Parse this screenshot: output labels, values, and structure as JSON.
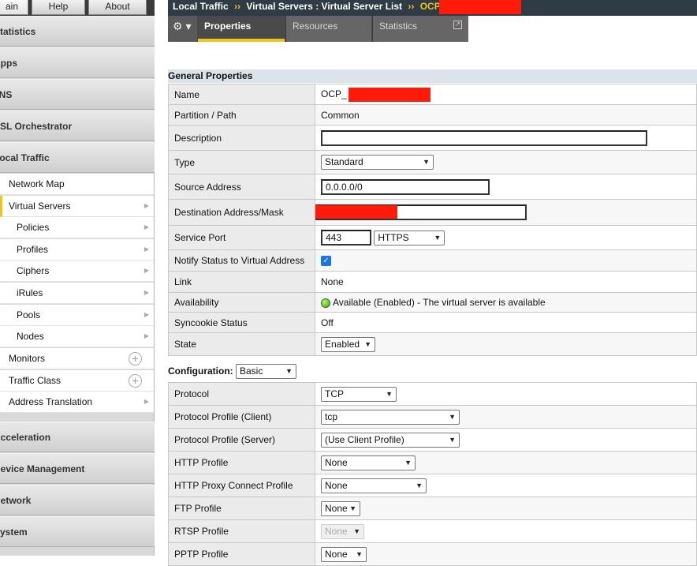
{
  "topnav": {
    "tabs": [
      "ain",
      "Help",
      "About"
    ]
  },
  "sidebar": {
    "sections_top": [
      "Statistics",
      "Apps",
      "DNS",
      "SSL Orchestrator",
      "Local Traffic"
    ],
    "local_traffic_items": [
      {
        "label": "Network Map",
        "level": 1,
        "marker": "none"
      },
      {
        "label": "Virtual Servers",
        "level": 1,
        "marker": "arrow"
      },
      {
        "label": "Policies",
        "level": 2,
        "marker": "arrow"
      },
      {
        "label": "Profiles",
        "level": 2,
        "marker": "arrow"
      },
      {
        "label": "Ciphers",
        "level": 2,
        "marker": "arrow"
      },
      {
        "label": "iRules",
        "level": 2,
        "marker": "arrow"
      },
      {
        "label": "Pools",
        "level": 2,
        "marker": "arrow"
      },
      {
        "label": "Nodes",
        "level": 2,
        "marker": "arrow"
      },
      {
        "label": "Monitors",
        "level": 1,
        "marker": "plus"
      },
      {
        "label": "Traffic Class",
        "level": 1,
        "marker": "plus"
      },
      {
        "label": "Address Translation",
        "level": 1,
        "marker": "arrow"
      }
    ],
    "sections_bottom": [
      "Acceleration",
      "Device Management",
      "Network",
      "System"
    ]
  },
  "header": {
    "crumb1": "Local Traffic",
    "crumb2": "Virtual Servers : Virtual Server List",
    "current": "OCP_",
    "sep": "››"
  },
  "tabs": {
    "gear": "⚙ ▾",
    "properties": "Properties",
    "resources": "Resources",
    "statistics": "Statistics"
  },
  "general": {
    "title": "General Properties",
    "name_label": "Name",
    "name_value": "OCP_",
    "partition_label": "Partition / Path",
    "partition_value": "Common",
    "description_label": "Description",
    "description_value": "",
    "type_label": "Type",
    "type_value": "Standard",
    "source_label": "Source Address",
    "source_value": "0.0.0.0/0",
    "dest_label": "Destination Address/Mask",
    "dest_value": "",
    "port_label": "Service Port",
    "port_value": "443",
    "port_service": "HTTPS",
    "notify_label": "Notify Status to Virtual Address",
    "notify_checked": true,
    "link_label": "Link",
    "link_value": "None",
    "avail_label": "Availability",
    "avail_value": "Available (Enabled) - The virtual server is available",
    "syncookie_label": "Syncookie Status",
    "syncookie_value": "Off",
    "state_label": "State",
    "state_value": "Enabled"
  },
  "configuration": {
    "label": "Configuration:",
    "mode": "Basic",
    "rows": [
      {
        "label": "Protocol",
        "value": "TCP",
        "disabled": false
      },
      {
        "label": "Protocol Profile (Client)",
        "value": "tcp",
        "disabled": false
      },
      {
        "label": "Protocol Profile (Server)",
        "value": "(Use Client Profile)",
        "disabled": false
      },
      {
        "label": "HTTP Profile",
        "value": "None",
        "disabled": false
      },
      {
        "label": "HTTP Proxy Connect Profile",
        "value": "None",
        "disabled": false
      },
      {
        "label": "FTP Profile",
        "value": "None",
        "disabled": false
      },
      {
        "label": "RTSP Profile",
        "value": "None",
        "disabled": true
      },
      {
        "label": "PPTP Profile",
        "value": "None",
        "disabled": false
      }
    ]
  },
  "colors": {
    "accent": "#f0c419",
    "header_bg": "#2f3b45",
    "redaction": "#ff1a0a"
  }
}
